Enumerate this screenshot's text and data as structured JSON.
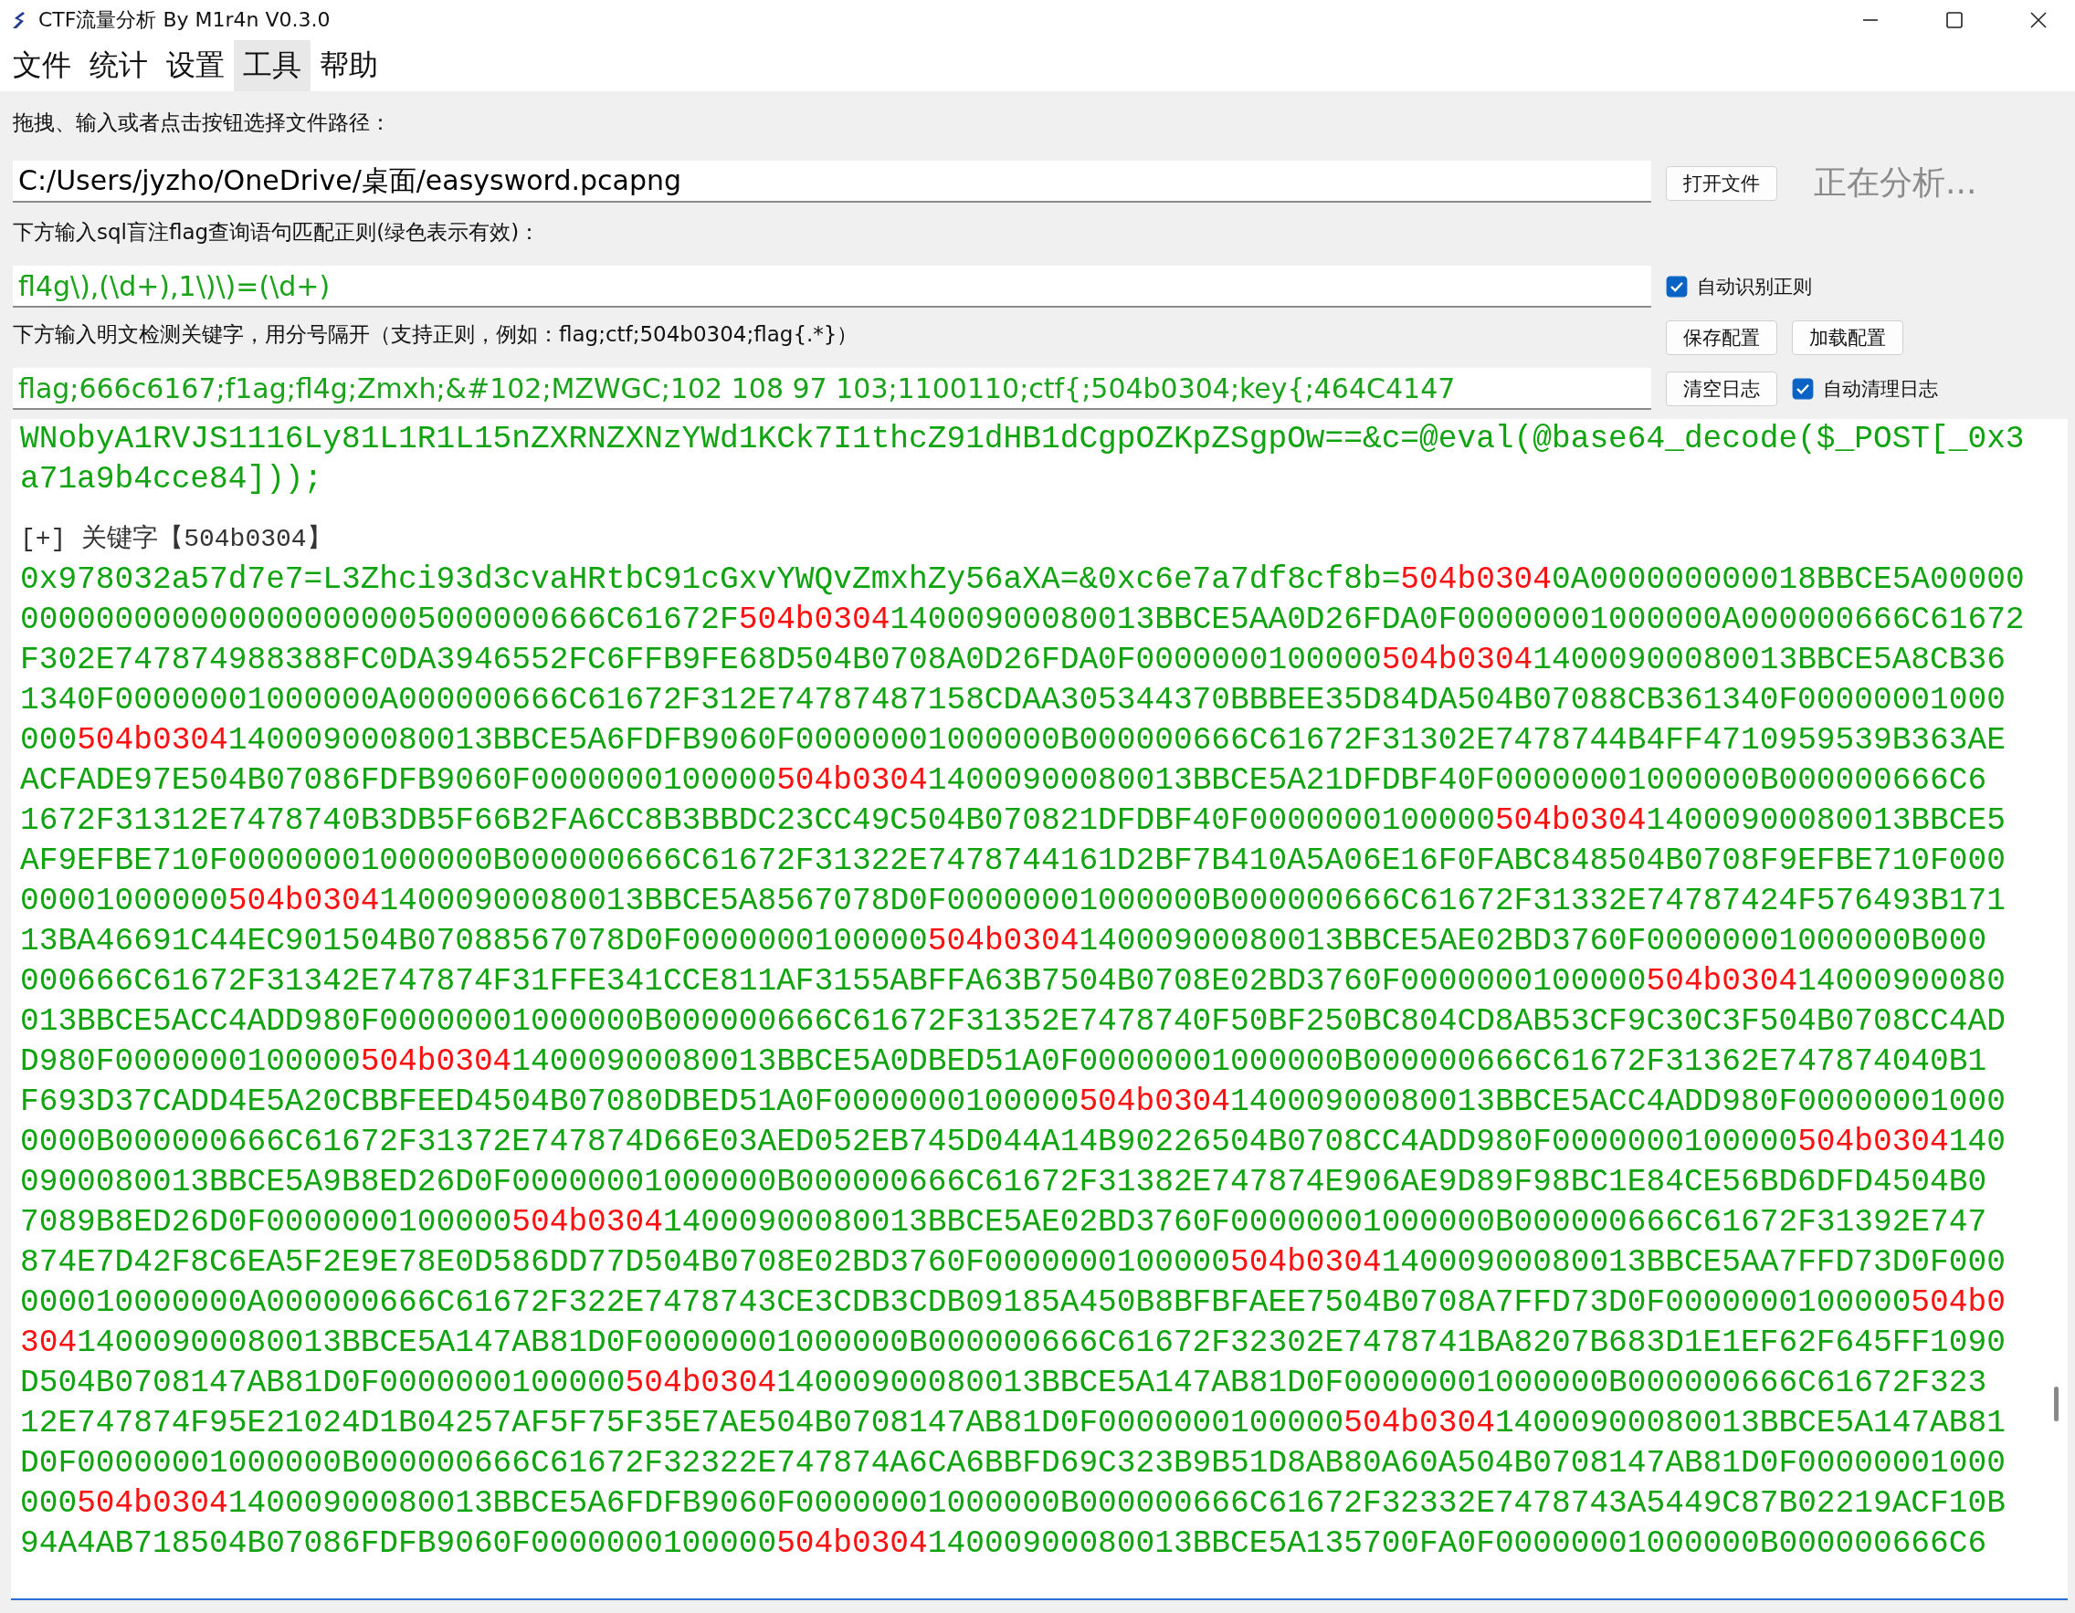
{
  "window": {
    "title": "CTF流量分析 By M1r4n V0.3.0"
  },
  "menu": [
    {
      "label": "文件",
      "highlighted": false
    },
    {
      "label": "统计",
      "highlighted": false
    },
    {
      "label": "设置",
      "highlighted": false
    },
    {
      "label": "工具",
      "highlighted": true
    },
    {
      "label": "帮助",
      "highlighted": false
    }
  ],
  "file_section": {
    "label": "拖拽、输入或者点击按钮选择文件路径：",
    "path_value": "C:/Users/jyzho/OneDrive/桌面/easysword.pcapng",
    "open_button": "打开文件",
    "status": "正在分析..."
  },
  "regex_section": {
    "label": "下方输入sql盲注flag查询语句匹配正则(绿色表示有效)：",
    "value": "fl4g\\),(\\d+),1\\)\\)=(\\d+)",
    "valid": true,
    "auto_detect": {
      "label": "自动识别正则",
      "checked": true
    }
  },
  "keyword_section": {
    "label": "下方输入明文检测关键字，用分号隔开（支持正则，例如：flag;ctf;504b0304;flag{.*}）",
    "save_button": "保存配置",
    "load_button": "加载配置",
    "value": "flag;666c6167;f1ag;fl4g;Zmxh;&#102;MZWGC;102 108 97 103;1100110;ctf{;504b0304;key{;464C4147",
    "valid": true,
    "clear_button": "清空日志",
    "auto_clear": {
      "label": "自动清理日志",
      "checked": true
    }
  },
  "log": {
    "lines": [
      {
        "kind": "code",
        "segments": [
          {
            "text": "WNobyA1RVJS1116Ly81L1R1L15nZXRNZXNzYWd1KCk7I1thcZ91dHB1dCgpOZKpZSgpOw==&c=@eval(@base64_decode($_POST[_0x3",
            "match": false
          }
        ]
      },
      {
        "kind": "code",
        "segments": [
          {
            "text": "a71a9b4cce84]));",
            "match": false
          }
        ]
      },
      {
        "kind": "blank"
      },
      {
        "kind": "heading",
        "segments": [
          {
            "text": "[+] 关键字【504b0304】",
            "match": false
          }
        ]
      },
      {
        "kind": "code",
        "segments": [
          {
            "text": "0x978032a57d7e7=L3Zhci93d3cvaHRtbC91cGxvYWQvZmxhZy56aXA=&0xc6e7a7df8cf8b=",
            "match": false
          },
          {
            "text": "504b0304",
            "match": true
          },
          {
            "text": "0A000000000018BBCE5A00000",
            "match": false
          }
        ]
      },
      {
        "kind": "code",
        "segments": [
          {
            "text": "0000000000000000000005000000666C61672F",
            "match": false
          },
          {
            "text": "504b0304",
            "match": true
          },
          {
            "text": "14000900080013BBCE5AA0D26FDA0F00000001000000A000000666C61672",
            "match": false
          }
        ]
      },
      {
        "kind": "code",
        "segments": [
          {
            "text": "F302E747874988388FC0DA3946552FC6FFB9FE68D504B0708A0D26FDA0F0000000100000",
            "match": false
          },
          {
            "text": "504b0304",
            "match": true
          },
          {
            "text": "14000900080013BBCE5A8CB36",
            "match": false
          }
        ]
      },
      {
        "kind": "code",
        "segments": [
          {
            "text": "1340F00000001000000A000000666C61672F312E74787487158CDAA305344370BBBEE35D84DA504B07088CB361340F00000001000",
            "match": false
          }
        ]
      },
      {
        "kind": "code",
        "segments": [
          {
            "text": "000",
            "match": false
          },
          {
            "text": "504b0304",
            "match": true
          },
          {
            "text": "14000900080013BBCE5A6FDFB9060F00000001000000B000000666C61672F31302E7478744B4FF4710959539B363AE",
            "match": false
          }
        ]
      },
      {
        "kind": "code",
        "segments": [
          {
            "text": "ACFADE97E504B07086FDFB9060F0000000100000",
            "match": false
          },
          {
            "text": "504b0304",
            "match": true
          },
          {
            "text": "14000900080013BBCE5A21DFDBF40F00000001000000B000000666C6",
            "match": false
          }
        ]
      },
      {
        "kind": "code",
        "segments": [
          {
            "text": "1672F31312E7478740B3DB5F66B2FA6CC8B3BBDC23CC49C504B070821DFDBF40F0000000100000",
            "match": false
          },
          {
            "text": "504b0304",
            "match": true
          },
          {
            "text": "14000900080013BBCE5",
            "match": false
          }
        ]
      },
      {
        "kind": "code",
        "segments": [
          {
            "text": "AF9EFBE710F00000001000000B000000666C61672F31322E7478744161D2BF7B410A5A06E16F0FABC848504B0708F9EFBE710F000",
            "match": false
          }
        ]
      },
      {
        "kind": "code",
        "segments": [
          {
            "text": "00001000000",
            "match": false
          },
          {
            "text": "504b0304",
            "match": true
          },
          {
            "text": "14000900080013BBCE5A8567078D0F00000001000000B000000666C61672F31332E74787424F576493B171",
            "match": false
          }
        ]
      },
      {
        "kind": "code",
        "segments": [
          {
            "text": "13BA46691C44EC901504B07088567078D0F0000000100000",
            "match": false
          },
          {
            "text": "504b0304",
            "match": true
          },
          {
            "text": "14000900080013BBCE5AE02BD3760F00000001000000B000",
            "match": false
          }
        ]
      },
      {
        "kind": "code",
        "segments": [
          {
            "text": "000666C61672F31342E747874F31FFE341CCE811AF3155ABFFA63B7504B0708E02BD3760F0000000100000",
            "match": false
          },
          {
            "text": "504b0304",
            "match": true
          },
          {
            "text": "14000900080",
            "match": false
          }
        ]
      },
      {
        "kind": "code",
        "segments": [
          {
            "text": "013BBCE5ACC4ADD980F00000001000000B000000666C61672F31352E7478740F50BF250BC804CD8AB53CF9C30C3F504B0708CC4AD",
            "match": false
          }
        ]
      },
      {
        "kind": "code",
        "segments": [
          {
            "text": "D980F0000000100000",
            "match": false
          },
          {
            "text": "504b0304",
            "match": true
          },
          {
            "text": "14000900080013BBCE5A0DBED51A0F00000001000000B000000666C61672F31362E747874040B1",
            "match": false
          }
        ]
      },
      {
        "kind": "code",
        "segments": [
          {
            "text": "F693D37CADD4E5A20CBBFEED4504B07080DBED51A0F0000000100000",
            "match": false
          },
          {
            "text": "504b0304",
            "match": true
          },
          {
            "text": "14000900080013BBCE5ACC4ADD980F00000001000",
            "match": false
          }
        ]
      },
      {
        "kind": "code",
        "segments": [
          {
            "text": "0000B000000666C61672F31372E747874D66E03AED052EB745D044A14B90226504B0708CC4ADD980F0000000100000",
            "match": false
          },
          {
            "text": "504b0304",
            "match": true
          },
          {
            "text": "140",
            "match": false
          }
        ]
      },
      {
        "kind": "code",
        "segments": [
          {
            "text": "0900080013BBCE5A9B8ED26D0F00000001000000B000000666C61672F31382E747874E906AE9D89F98BC1E84CE56BD6DFD4504B0",
            "match": false
          }
        ]
      },
      {
        "kind": "code",
        "segments": [
          {
            "text": "7089B8ED26D0F0000000100000",
            "match": false
          },
          {
            "text": "504b0304",
            "match": true
          },
          {
            "text": "14000900080013BBCE5AE02BD3760F00000001000000B000000666C61672F31392E747",
            "match": false
          }
        ]
      },
      {
        "kind": "code",
        "segments": [
          {
            "text": "874E7D42F8C6EA5F2E9E78E0D586DD77D504B0708E02BD3760F0000000100000",
            "match": false
          },
          {
            "text": "504b0304",
            "match": true
          },
          {
            "text": "14000900080013BBCE5AA7FFD73D0F000",
            "match": false
          }
        ]
      },
      {
        "kind": "code",
        "segments": [
          {
            "text": "000010000000A000000666C61672F322E7478743CE3CDB3CDB09185A450B8BFBFAEE7504B0708A7FFD73D0F0000000100000",
            "match": false
          },
          {
            "text": "504b0",
            "match": true
          }
        ]
      },
      {
        "kind": "code",
        "segments": [
          {
            "text": "304",
            "match": true
          },
          {
            "text": "14000900080013BBCE5A147AB81D0F00000001000000B000000666C61672F32302E7478741BA8207B683D1E1EF62F645FF1090",
            "match": false
          }
        ]
      },
      {
        "kind": "code",
        "segments": [
          {
            "text": "D504B0708147AB81D0F0000000100000",
            "match": false
          },
          {
            "text": "504b0304",
            "match": true
          },
          {
            "text": "14000900080013BBCE5A147AB81D0F00000001000000B000000666C61672F323",
            "match": false
          }
        ]
      },
      {
        "kind": "code",
        "segments": [
          {
            "text": "12E747874F95E21024D1B04257AF5F75F35E7AE504B0708147AB81D0F0000000100000",
            "match": false
          },
          {
            "text": "504b0304",
            "match": true
          },
          {
            "text": "14000900080013BBCE5A147AB81",
            "match": false
          }
        ]
      },
      {
        "kind": "code",
        "segments": [
          {
            "text": "D0F00000001000000B000000666C61672F32322E747874A6CA6BBFD69C323B9B51D8AB80A60A504B0708147AB81D0F00000001000",
            "match": false
          }
        ]
      },
      {
        "kind": "code",
        "segments": [
          {
            "text": "000",
            "match": false
          },
          {
            "text": "504b0304",
            "match": true
          },
          {
            "text": "14000900080013BBCE5A6FDFB9060F00000001000000B000000666C61672F32332E7478743A5449C87B02219ACF10B",
            "match": false
          }
        ]
      },
      {
        "kind": "code",
        "segments": [
          {
            "text": "94A4AB718504B07086FDFB9060F0000000100000",
            "match": false
          },
          {
            "text": "504b0304",
            "match": true
          },
          {
            "text": "14000900080013BBCE5A135700FA0F00000001000000B000000666C6",
            "match": false
          }
        ]
      }
    ]
  }
}
